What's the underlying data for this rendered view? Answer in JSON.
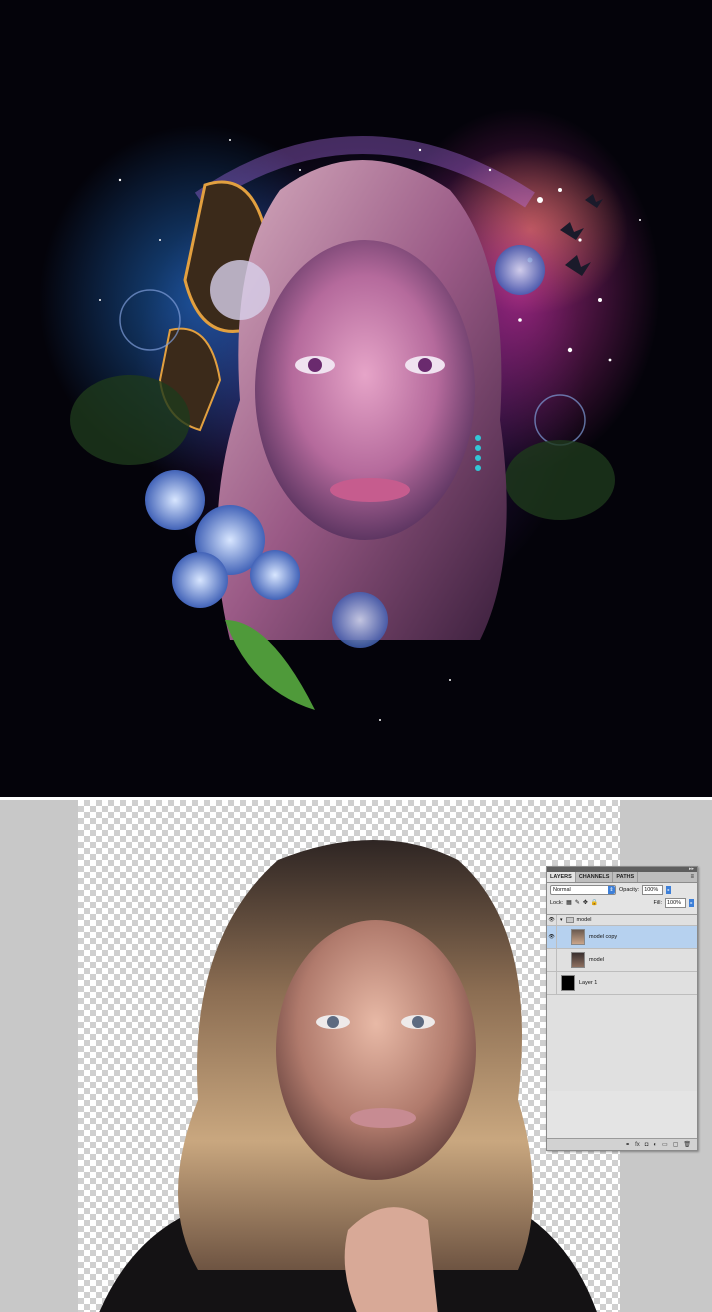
{
  "panel": {
    "tabs": [
      "LAYERS",
      "CHANNELS",
      "PATHS"
    ],
    "blend_mode": "Normal",
    "opacity_label": "Opacity:",
    "opacity_value": "100%",
    "lock_label": "Lock:",
    "fill_label": "Fill:",
    "fill_value": "100%",
    "layers": [
      {
        "name": "model",
        "type": "group",
        "visible": true
      },
      {
        "name": "model copy",
        "type": "layer",
        "visible": true,
        "selected": true
      },
      {
        "name": "model",
        "type": "layer",
        "visible": false
      },
      {
        "name": "Layer 1",
        "type": "layer",
        "visible": false
      }
    ]
  },
  "icons": {
    "visibility": "eye-icon",
    "group": "folder-icon",
    "link": "link-layers-icon",
    "fx": "layer-style-icon",
    "mask": "add-mask-icon",
    "adjustment": "adjustment-layer-icon",
    "new_group": "new-group-icon",
    "new_layer": "new-layer-icon",
    "delete": "trash-icon"
  }
}
